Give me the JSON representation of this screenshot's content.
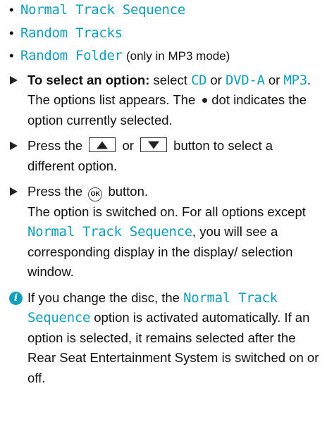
{
  "options_list": [
    {
      "label": "Normal Track Sequence",
      "suffix": ""
    },
    {
      "label": "Random Tracks",
      "suffix": ""
    },
    {
      "label": "Random Folder",
      "suffix": "(only in MP3 mode)"
    }
  ],
  "step1": {
    "lead": "To select an option:",
    "t1": "select",
    "cd": "CD",
    "t2": "or",
    "dvda": "DVD-A",
    "t3": "or",
    "mp3": "MP3",
    "t4": ".",
    "result_a": "The options list appears. The",
    "result_b": "dot indicates the option currently selected."
  },
  "step2": {
    "t1": "Press the",
    "t2": "or",
    "t3": "button to select a different option.",
    "up_key_icon": "up-arrow-button-icon",
    "down_key_icon": "down-arrow-button-icon"
  },
  "step3": {
    "t1": "Press the",
    "ok_label": "OK",
    "t2": "button.",
    "r1": "The option is switched on. For all options except",
    "r_ui": "Normal Track Sequence",
    "r2": ", you will see a corresponding display in the display/ selection window."
  },
  "note": {
    "icon": "info-icon",
    "icon_glyph": "i",
    "t1": "If you change the disc, the",
    "ui": "Normal Track Sequence",
    "t2": "option is activated automatically. If an option is selected, it remains selected after the Rear Seat Entertainment System is switched on or off."
  },
  "colors": {
    "accent": "#0f9fbd",
    "text": "#111111"
  }
}
